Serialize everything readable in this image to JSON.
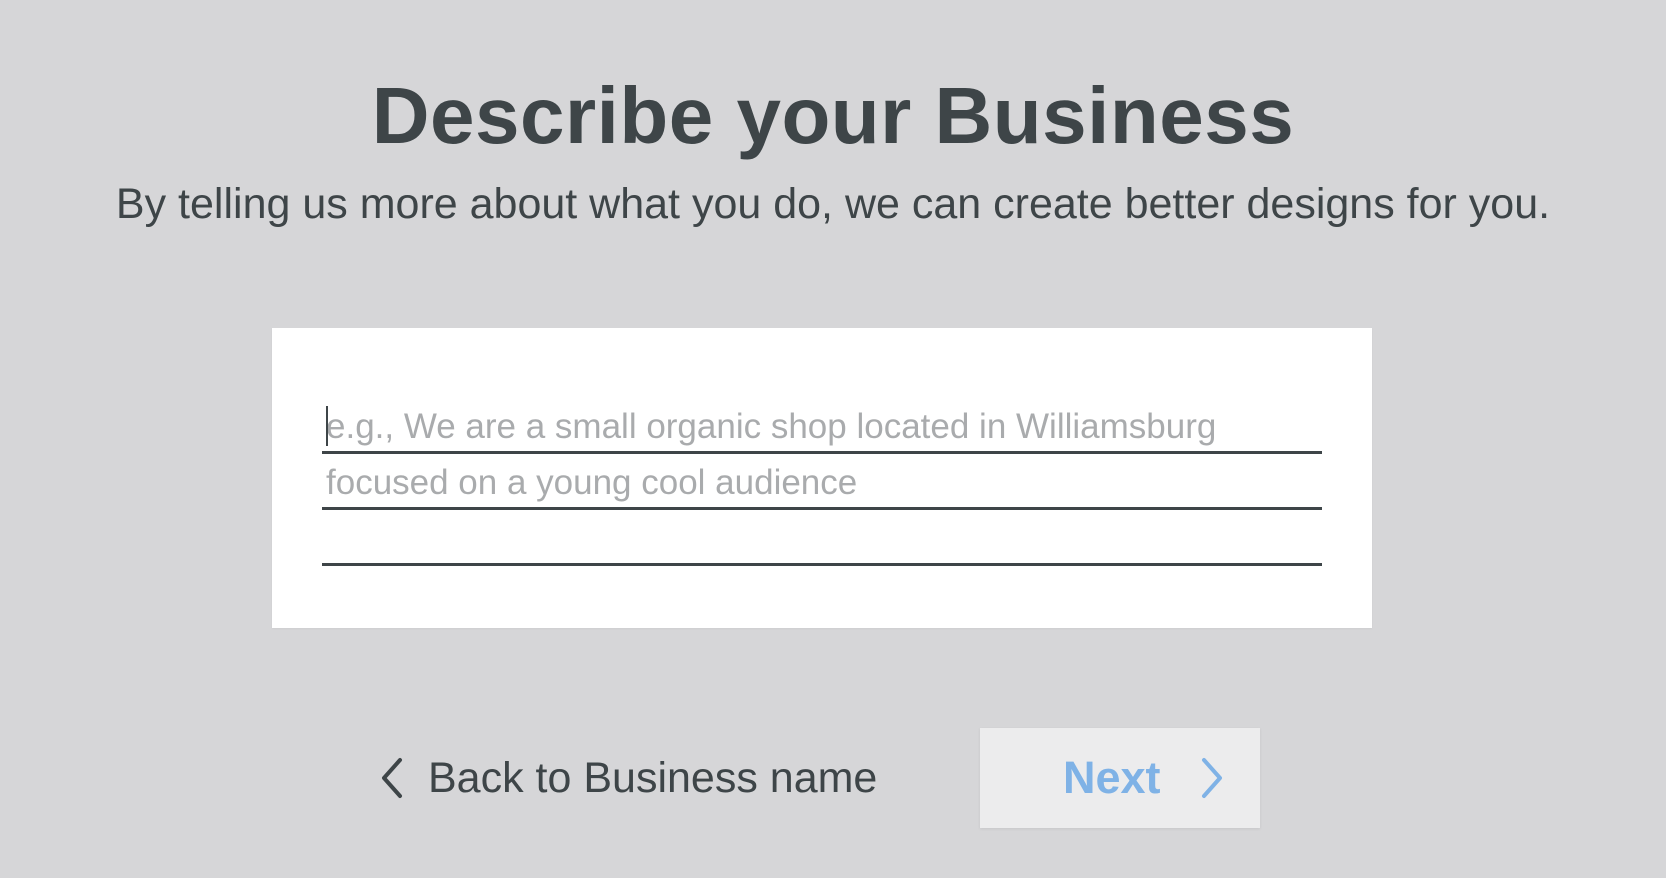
{
  "header": {
    "title": "Describe your Business",
    "subtitle": "By telling us more about what you do, we can create better designs for you."
  },
  "description_field": {
    "placeholder_line_1": "e.g., We are a small organic shop located in Williamsburg",
    "placeholder_line_2": "focused on a young cool audience",
    "value": ""
  },
  "navigation": {
    "back_label": "Back to Business name",
    "next_label": "Next"
  },
  "colors": {
    "background": "#d6d6d8",
    "text": "#3e4548",
    "placeholder": "#a9abad",
    "next_accent": "#7fb2e6",
    "next_button_bg": "#ececed"
  },
  "icons": {
    "back": "chevron-left-icon",
    "next": "chevron-right-icon"
  }
}
